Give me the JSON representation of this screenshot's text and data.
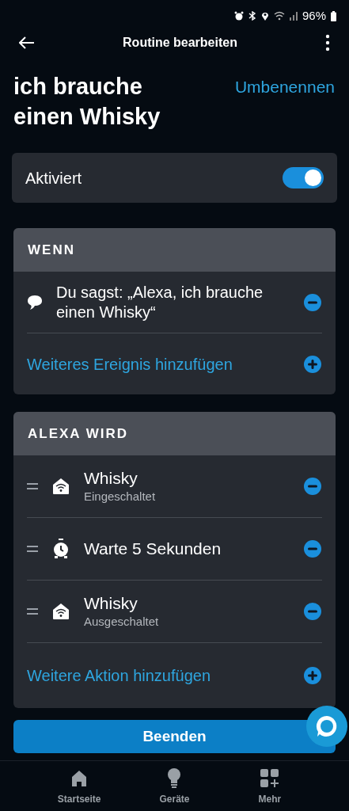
{
  "status_bar": {
    "battery": "96%"
  },
  "header": {
    "title": "Routine bearbeiten"
  },
  "routine": {
    "name": "ich brauche einen Whisky",
    "rename": "Umbenennen"
  },
  "enabled": {
    "label": "Aktiviert",
    "on": true
  },
  "when": {
    "heading": "WENN",
    "triggers": [
      {
        "text": "Du sagst: „Alexa, ich brauche einen Whisky“"
      }
    ],
    "add": "Weiteres Ereignis hinzufügen"
  },
  "actions": {
    "heading": "ALEXA WIRD",
    "items": [
      {
        "kind": "device",
        "title": "Whisky",
        "subtitle": "Eingeschaltet"
      },
      {
        "kind": "wait",
        "title": "Warte 5 Sekunden"
      },
      {
        "kind": "device",
        "title": "Whisky",
        "subtitle": "Ausgeschaltet"
      }
    ],
    "add": "Weitere Aktion hinzufügen"
  },
  "finish_button": "Beenden",
  "nav": [
    {
      "label": "Startseite",
      "kind": "home",
      "selected": false
    },
    {
      "label": "Geräte",
      "kind": "devices",
      "selected": false
    },
    {
      "label": "Mehr",
      "kind": "more",
      "selected": false
    }
  ]
}
